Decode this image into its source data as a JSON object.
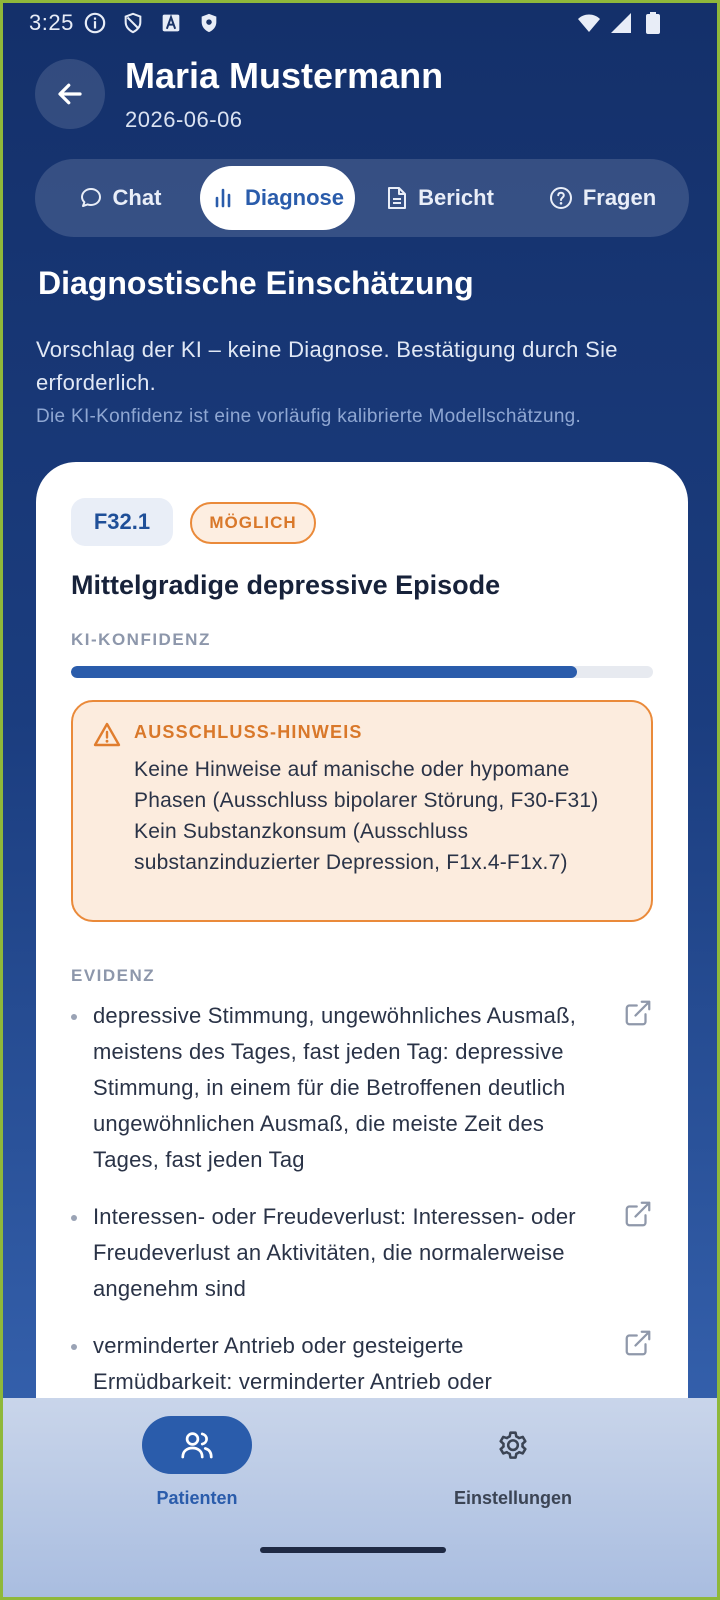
{
  "status_bar": {
    "time": "3:25",
    "icons": [
      "info-icon",
      "shield-icon",
      "a-icon",
      "shield-filled-icon",
      "wifi-icon",
      "signal-icon",
      "battery-icon"
    ]
  },
  "header": {
    "title": "Maria Mustermann",
    "date": "2026-06-06"
  },
  "tabs": [
    {
      "label": "Chat",
      "icon": "chat-icon",
      "active": false
    },
    {
      "label": "Diagnose",
      "icon": "bar-chart-icon",
      "active": true
    },
    {
      "label": "Bericht",
      "icon": "document-icon",
      "active": false
    },
    {
      "label": "Fragen",
      "icon": "question-icon",
      "active": false
    }
  ],
  "section": {
    "title": "Diagnostische Einschätzung",
    "intro": "Vorschlag der KI – keine Diagnose. Bestätigung durch Sie erforderlich.",
    "note": "Die KI-Konfidenz ist eine vorläufig kalibrierte Modellschätzung."
  },
  "diagnosis": {
    "code": "F32.1",
    "status": "MÖGLICH",
    "name": "Mittelgradige depressive Episode",
    "confidence_label": "KI-KONFIDENZ",
    "confidence": 0.87,
    "exclusion": {
      "title": "AUSSCHLUSS-HINWEIS",
      "lines": [
        "Keine Hinweise auf manische oder hypomane Phasen (Ausschluss bipolarer Störung, F30-F31)",
        "Kein Substanzkonsum (Ausschluss substanzinduzierter Depression, F1x.4-F1x.7)"
      ]
    },
    "evidence_label": "EVIDENZ",
    "evidence": [
      "depressive Stimmung, ungewöhnliches Ausmaß, meistens des Tages, fast jeden Tag: depressive Stimmung, in einem für die Betroffenen deutlich ungewöhnlichen Ausmaß, die meiste Zeit des Tages, fast jeden Tag",
      "Interessen- oder Freudeverlust: Interessen- oder Freudeverlust an Aktivitäten, die normalerweise angenehm sind",
      "verminderter Antrieb oder gesteigerte Ermüdbarkeit: verminderter Antrieb oder"
    ]
  },
  "bottom_nav": [
    {
      "label": "Patienten",
      "icon": "users-icon",
      "active": true
    },
    {
      "label": "Einstellungen",
      "icon": "gear-icon",
      "active": false
    }
  ],
  "colors": {
    "accent": "#2a5cab",
    "warning": "#ea8a3a",
    "background_top": "#14306a",
    "background_bottom": "#3d69b4"
  }
}
